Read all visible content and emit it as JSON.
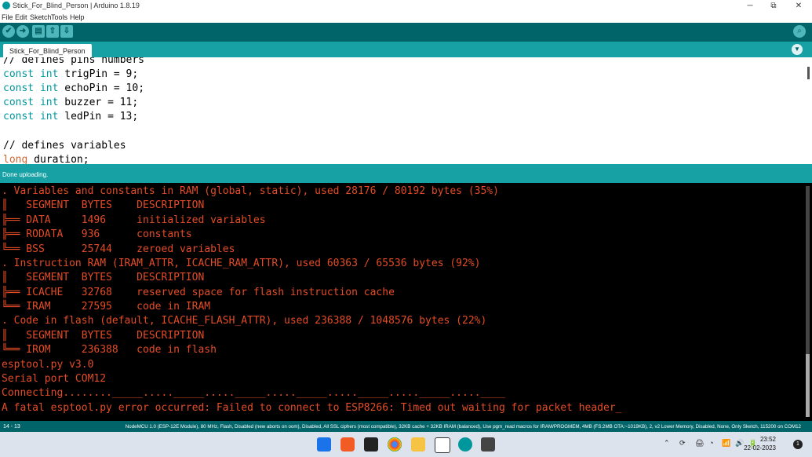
{
  "window": {
    "title": "Stick_For_Blind_Person | Arduino 1.8.19",
    "minimize": "─",
    "maximize": "⧉",
    "close": "✕"
  },
  "menu": [
    "File",
    "Edit",
    "Sketch",
    "Tools",
    "Help"
  ],
  "toolbar": {
    "verify_icon": "✔",
    "upload_icon": "➜",
    "new_icon": "▤",
    "open_icon": "⇧",
    "save_icon": "⇩",
    "serial_icon": "⌕"
  },
  "tab": {
    "label": "Stick_For_Blind_Person",
    "menu_icon": "▼"
  },
  "editor": {
    "lines": [
      "// defines pins numbers",
      "const int trigPin = 9;",
      "const int echoPin = 10;",
      "const int buzzer = 11;",
      "const int ledPin = 13;",
      "",
      "// defines variables",
      "long duration;"
    ]
  },
  "status": "Done uploading.",
  "console": {
    "lines": [
      ". Variables and constants in RAM (global, static), used 28176 / 80192 bytes (35%)",
      "║   SEGMENT  BYTES    DESCRIPTION",
      "╠══ DATA     1496     initialized variables",
      "╠══ RODATA   936      constants",
      "╚══ BSS      25744    zeroed variables",
      ". Instruction RAM (IRAM_ATTR, ICACHE_RAM_ATTR), used 60363 / 65536 bytes (92%)",
      "║   SEGMENT  BYTES    DESCRIPTION",
      "╠══ ICACHE   32768    reserved space for flash instruction cache",
      "╚══ IRAM     27595    code in IRAM",
      ". Code in flash (default, ICACHE_FLASH_ATTR), used 236388 / 1048576 bytes (22%)",
      "║   SEGMENT  BYTES    DESCRIPTION",
      "╚══ IROM     236388   code in flash",
      "esptool.py v3.0",
      "Serial port COM12",
      "Connecting........_____....._____....._____....._____....._____....._____.....____",
      "A fatal esptool.py error occurred: Failed to connect to ESP8266: Timed out waiting for packet header_"
    ]
  },
  "footer": {
    "line_number": "14 - 13",
    "board": "NodeMCU 1.0 (ESP-12E Module), 80 MHz, Flash, Disabled (new aborts on oom), Disabled, All SSL ciphers (most compatible), 32KB cache + 32KB IRAM (balanced), Use pgm_read macros for IRAM/PROGMEM, 4MB (FS:2MB OTA:~1019KB), 2, v2 Lower Memory, Disabled, None, Only Sketch, 115200 on COM12"
  },
  "taskbar": {
    "time": "23:52",
    "date": "22-02-2023",
    "notifications": "1",
    "tray_icons": [
      "⌃",
      "⟳",
      "🖨",
      "◔",
      "📶",
      "🔊",
      "🔋"
    ],
    "apps": [
      "windows-start",
      "brave",
      "notion",
      "chrome",
      "file-explorer",
      "screen-capture",
      "arduino",
      "snipping"
    ]
  }
}
